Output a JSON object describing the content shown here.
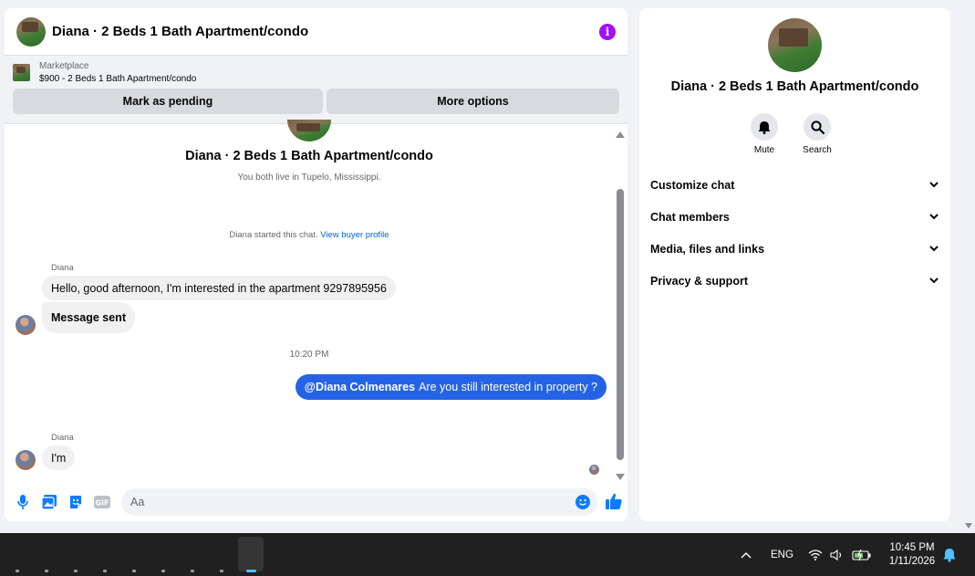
{
  "chat": {
    "title": "Diana · 2 Beds 1 Bath Apartment/condo",
    "info_icon": "info-icon",
    "marketplace": {
      "label": "Marketplace",
      "listing": "$900 - 2 Beds 1 Bath Apartment/condo",
      "mark_pending": "Mark as pending",
      "more_options": "More options"
    },
    "intro": {
      "name": "Diana · 2 Beds 1 Bath Apartment/condo",
      "subtitle": "You both live in Tupelo, Mississippi.",
      "started": "Diana started this chat.",
      "view_buyer_profile": "View buyer profile"
    },
    "messages": [
      {
        "sender": "Diana",
        "text": "Hello, good afternoon, I'm interested in the apartment 9297895956"
      },
      {
        "text": "Message sent"
      },
      {
        "timestamp": "10:20 PM"
      },
      {
        "mention": "@Diana Colmenares",
        "text": "Are you still interested in property ?"
      },
      {
        "sender": "Diana",
        "text": "I'm"
      }
    ],
    "composer": {
      "placeholder": "Aa",
      "icons": [
        "microphone-icon",
        "photo-icon",
        "sticker-icon",
        "gif-icon",
        "emoji-icon",
        "thumbs-up-icon"
      ],
      "gif_label": "GIF"
    }
  },
  "side": {
    "title": "Diana · 2 Beds 1 Bath Apartment/condo",
    "actions": [
      {
        "label": "Mute",
        "icon": "bell-icon"
      },
      {
        "label": "Search",
        "icon": "search-icon"
      }
    ],
    "menu": [
      {
        "label": "Customize chat"
      },
      {
        "label": "Chat members"
      },
      {
        "label": "Media, files and links"
      },
      {
        "label": "Privacy & support"
      }
    ]
  },
  "taskbar": {
    "language": "ENG",
    "time": "10:45 PM",
    "date": "1/11/2026",
    "colors": {
      "background": "#202020",
      "accent": "#4cc2ff"
    }
  },
  "colors": {
    "outgoing_bubble": "#2563e6",
    "incoming_bubble": "#f0f0f0",
    "info": "#a40ff4",
    "link": "#0064d1",
    "messenger_blue": "#0a7cff"
  }
}
